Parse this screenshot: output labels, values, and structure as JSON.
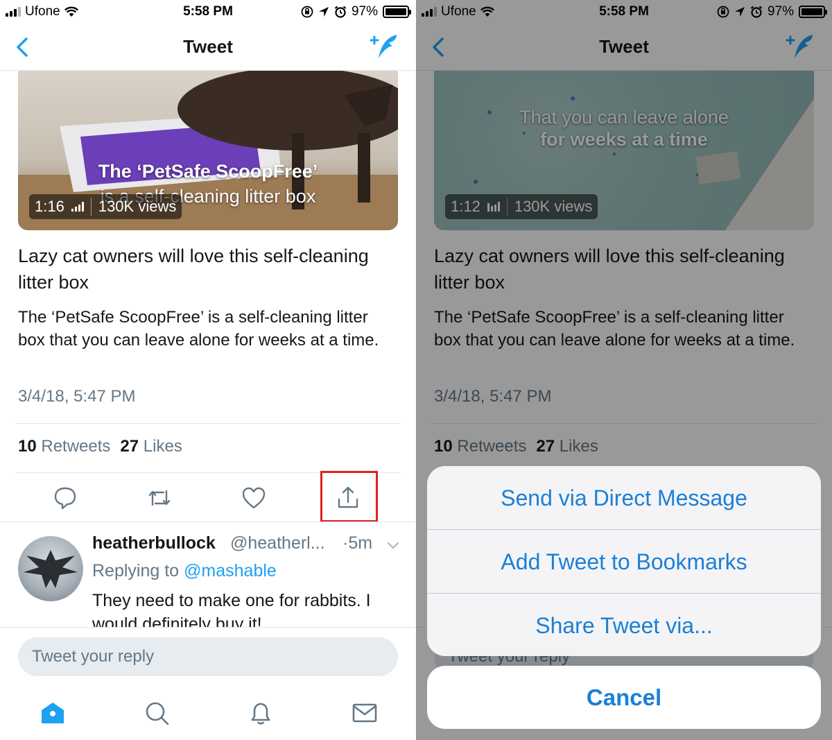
{
  "colors": {
    "accent": "#1da1f2",
    "secondary_text": "#657786",
    "highlight_box": "#e02020",
    "sheet_text": "#1b7fd6"
  },
  "left": {
    "status": {
      "carrier": "Ufone",
      "time": "5:58 PM",
      "battery": "97%"
    },
    "nav": {
      "title": "Tweet",
      "back_icon": "chevron-left-icon",
      "compose_icon": "compose-tweet-icon"
    },
    "video": {
      "caption_line1": "The ‘PetSafe ScoopFree’",
      "caption_line2": "is a self-cleaning litter box",
      "duration": "1:16",
      "views": "130K views"
    },
    "card": {
      "headline": "Lazy cat owners will love this self-cleaning litter box",
      "description": "The ‘PetSafe ScoopFree’ is a self-cleaning litter box that you can leave alone for weeks at a time."
    },
    "tweet": {
      "date": "3/4/18, 5:47 PM",
      "retweets_count": "10",
      "retweets_label": "Retweets",
      "likes_count": "27",
      "likes_label": "Likes"
    },
    "reply": {
      "name": "heatherbullock",
      "handle": "@heatherl...",
      "ago": "·5m",
      "replying_prefix": "Replying to",
      "replying_to": "@mashable",
      "text": "They need to make one for rabbits. I would definitely buy it!"
    },
    "reply_input": {
      "placeholder": "Tweet your reply"
    }
  },
  "right": {
    "status": {
      "carrier": "Ufone",
      "time": "5:58 PM",
      "battery": "97%"
    },
    "nav": {
      "title": "Tweet"
    },
    "video": {
      "caption_line1": "That you can leave alone",
      "caption_line2": "for weeks at a time",
      "duration": "1:12",
      "views": "130K views"
    },
    "card": {
      "headline": "Lazy cat owners will love this self-cleaning litter box",
      "description": "The ‘PetSafe ScoopFree’ is a self-cleaning litter box that you can leave alone for weeks at a time."
    },
    "tweet": {
      "date": "3/4/18, 5:47 PM",
      "retweets_count": "10",
      "retweets_label": "Retweets",
      "likes_count": "27",
      "likes_label": "Likes"
    },
    "sheet": {
      "options": [
        "Send via Direct Message",
        "Add Tweet to Bookmarks",
        "Share Tweet via..."
      ],
      "cancel": "Cancel"
    }
  }
}
